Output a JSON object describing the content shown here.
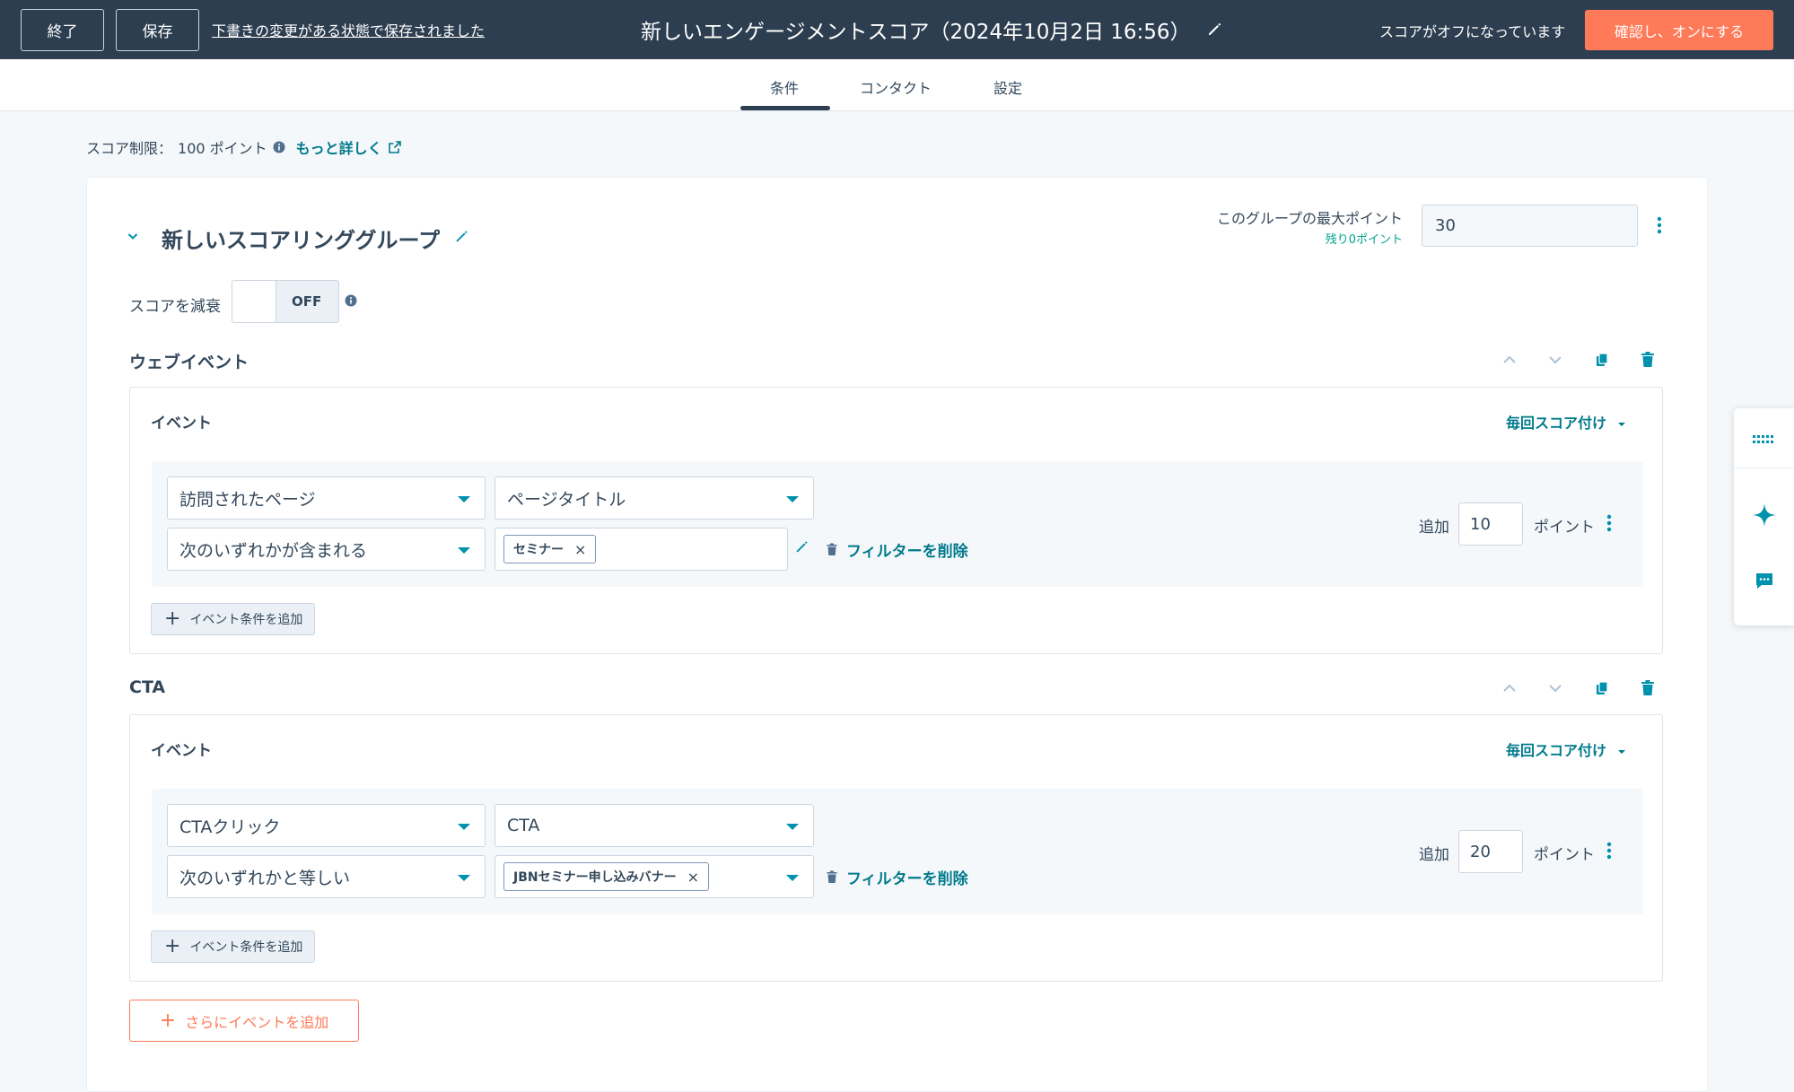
{
  "header": {
    "exit_label": "終了",
    "save_label": "保存",
    "saved_notice": "下書きの変更がある状態で保存されました",
    "title": "新しいエンゲージメントスコア（2024年10月2日 16:56）",
    "status_text": "スコアがオフになっています",
    "primary_button": "確認し、オンにする"
  },
  "tabs": [
    {
      "label": "条件",
      "active": true
    },
    {
      "label": "コンタクト",
      "active": false
    },
    {
      "label": "設定",
      "active": false
    }
  ],
  "score_limit": {
    "label": "スコア制限：",
    "value": "100 ポイント",
    "link": "もっと詳しく"
  },
  "group": {
    "title": "新しいスコアリンググループ",
    "max_points_label": "このグループの最大ポイント",
    "remaining_label": "残り0ポイント",
    "max_points_value": "30",
    "decay_label": "スコアを減衰",
    "decay_toggle": "OFF"
  },
  "sections": [
    {
      "title": "ウェブイベント",
      "event_label": "イベント",
      "scoring_mode": "毎回スコア付け",
      "event_type": "訪問されたページ",
      "property": "ページタイトル",
      "operator": "次のいずれかが含まれる",
      "chip": "セミナー",
      "delete_filter": "フィルターを削除",
      "add_label": "追加",
      "points": "10",
      "points_unit": "ポイント",
      "add_condition": "イベント条件を追加"
    },
    {
      "title": "CTA",
      "event_label": "イベント",
      "scoring_mode": "毎回スコア付け",
      "event_type": "CTAクリック",
      "property": "CTA",
      "operator": "次のいずれかと等しい",
      "chip": "JBNセミナー申し込みバナー",
      "delete_filter": "フィルターを削除",
      "add_label": "追加",
      "points": "20",
      "points_unit": "ポイント",
      "add_condition": "イベント条件を追加"
    }
  ],
  "add_more_events": "さらにイベントを追加",
  "colors": {
    "header_bg": "#2d3e50",
    "primary": "#ff7a59",
    "link": "#007a8c",
    "remaining": "#00a38d",
    "caret": "#0091ae"
  }
}
